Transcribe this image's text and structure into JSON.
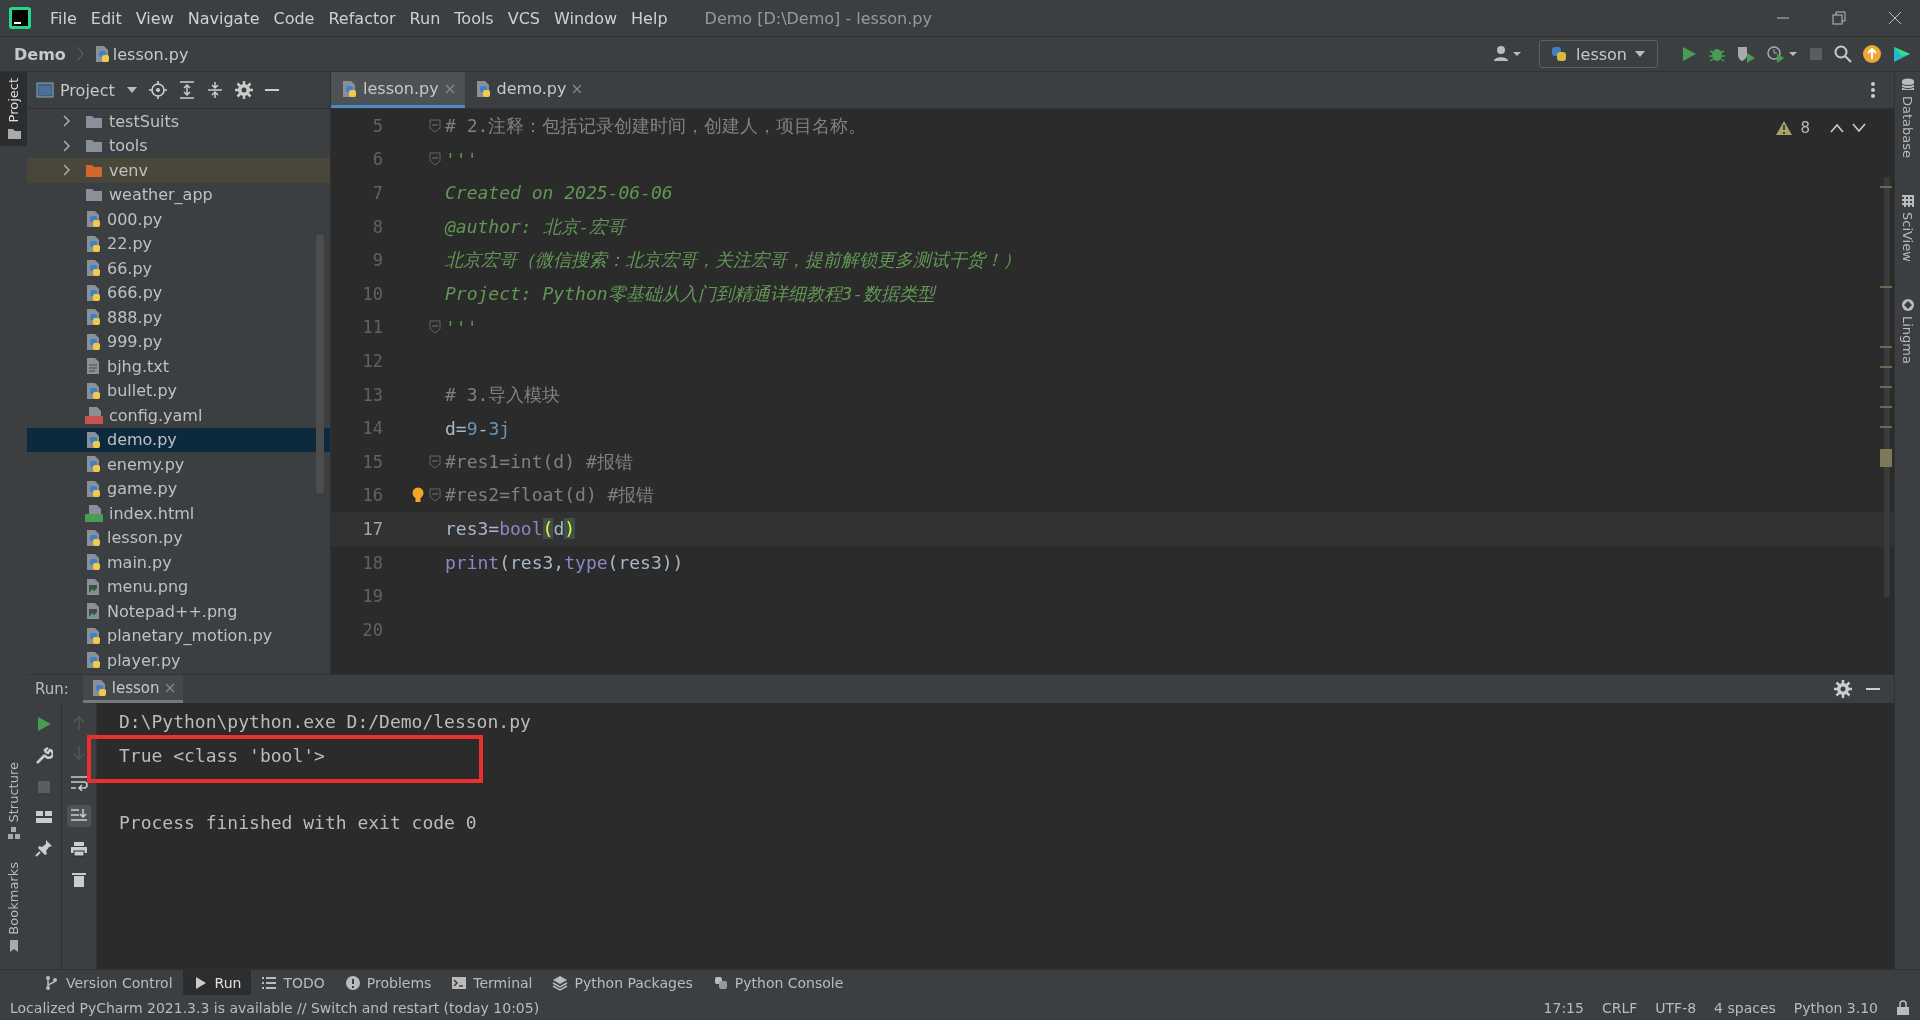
{
  "window": {
    "title": "Demo [D:\\Demo] - lesson.py"
  },
  "menu": [
    "File",
    "Edit",
    "View",
    "Navigate",
    "Code",
    "Refactor",
    "Run",
    "Tools",
    "VCS",
    "Window",
    "Help"
  ],
  "breadcrumb": [
    {
      "label": "Demo",
      "kind": "project"
    },
    {
      "label": "lesson.py",
      "kind": "python"
    }
  ],
  "run_config": {
    "label": "lesson"
  },
  "left_stripe": [
    {
      "label": "Project",
      "selected": true,
      "kind": "project"
    },
    {
      "label": "Structure",
      "selected": false,
      "kind": "structure"
    },
    {
      "label": "Bookmarks",
      "selected": false,
      "kind": "bookmarks"
    }
  ],
  "right_stripe": [
    {
      "label": "Database",
      "kind": "database"
    },
    {
      "label": "SciView",
      "kind": "sciview"
    },
    {
      "label": "Lingma",
      "kind": "lingma"
    }
  ],
  "project_panel": {
    "title": "Project",
    "items": [
      {
        "label": "testSuits",
        "kind": "folder",
        "expanded": false,
        "selected": false
      },
      {
        "label": "tools",
        "kind": "folder",
        "expanded": false,
        "selected": false
      },
      {
        "label": "venv",
        "kind": "excluded",
        "expanded": false,
        "selected": false
      },
      {
        "label": "weather_app",
        "kind": "folder",
        "selected": false
      },
      {
        "label": "000.py",
        "kind": "python",
        "selected": false
      },
      {
        "label": "22.py",
        "kind": "python",
        "selected": false
      },
      {
        "label": "66.py",
        "kind": "python",
        "selected": false
      },
      {
        "label": "666.py",
        "kind": "python",
        "selected": false
      },
      {
        "label": "888.py",
        "kind": "python",
        "selected": false
      },
      {
        "label": "999.py",
        "kind": "python",
        "selected": false
      },
      {
        "label": "bjhg.txt",
        "kind": "text",
        "selected": false
      },
      {
        "label": "bullet.py",
        "kind": "python",
        "selected": false
      },
      {
        "label": "config.yaml",
        "kind": "yaml",
        "selected": false
      },
      {
        "label": "demo.py",
        "kind": "python",
        "selected": true
      },
      {
        "label": "enemy.py",
        "kind": "python",
        "selected": false
      },
      {
        "label": "game.py",
        "kind": "python",
        "selected": false
      },
      {
        "label": "index.html",
        "kind": "html",
        "selected": false
      },
      {
        "label": "lesson.py",
        "kind": "python",
        "selected": false
      },
      {
        "label": "main.py",
        "kind": "python",
        "selected": false
      },
      {
        "label": "menu.png",
        "kind": "image",
        "selected": false
      },
      {
        "label": "Notepad++.png",
        "kind": "image",
        "selected": false
      },
      {
        "label": "planetary_motion.py",
        "kind": "python",
        "selected": false
      },
      {
        "label": "player.py",
        "kind": "python",
        "selected": false
      }
    ]
  },
  "editor": {
    "tabs": [
      {
        "label": "lesson.py",
        "selected": true
      },
      {
        "label": "demo.py",
        "selected": false
      }
    ],
    "warnings": "8",
    "lines": [
      {
        "number": "5",
        "fold": true,
        "current": false,
        "tokens": [
          {
            "kind": "comment",
            "text": "# 2.注释：包括记录创建时间，创建人，项目名称。"
          }
        ]
      },
      {
        "number": "6",
        "fold": true,
        "current": false,
        "tokens": [
          {
            "kind": "doc",
            "text": "'''"
          }
        ]
      },
      {
        "number": "7",
        "fold": false,
        "current": false,
        "tokens": [
          {
            "kind": "doc",
            "text": "Created on 2025-06-06"
          }
        ]
      },
      {
        "number": "8",
        "fold": false,
        "current": false,
        "tokens": [
          {
            "kind": "doc",
            "text": "@author: 北京-宏哥"
          }
        ]
      },
      {
        "number": "9",
        "fold": false,
        "current": false,
        "tokens": [
          {
            "kind": "doc",
            "text": "北京宏哥（微信搜索：北京宏哥，关注宏哥，提前解锁更多测试干货！）"
          }
        ]
      },
      {
        "number": "10",
        "fold": false,
        "current": false,
        "tokens": [
          {
            "kind": "doc",
            "text": "Project: Python零基础从入门到精通详细教程3-数据类型"
          }
        ]
      },
      {
        "number": "11",
        "fold": true,
        "current": false,
        "tokens": [
          {
            "kind": "doc",
            "text": "'''"
          }
        ]
      },
      {
        "number": "12",
        "fold": false,
        "current": false
      },
      {
        "number": "13",
        "fold": false,
        "current": false,
        "tokens": [
          {
            "kind": "comment",
            "text": "# 3.导入模块"
          }
        ]
      },
      {
        "number": "14",
        "fold": false,
        "current": false,
        "tokens": [
          {
            "kind": "plain",
            "text": "d="
          },
          {
            "kind": "number",
            "text": "9"
          },
          {
            "kind": "plain",
            "text": "-"
          },
          {
            "kind": "number",
            "text": "3j"
          }
        ]
      },
      {
        "number": "15",
        "fold": true,
        "current": false,
        "tokens": [
          {
            "kind": "comment",
            "text": "#res1=int(d) #报错"
          }
        ]
      },
      {
        "number": "16",
        "fold": true,
        "current": false,
        "bulb": true,
        "tokens": [
          {
            "kind": "comment",
            "text": "#res2=float(d) #报错"
          }
        ]
      },
      {
        "number": "17",
        "fold": false,
        "current": true,
        "tokens": [
          {
            "kind": "plain",
            "text": "res3="
          },
          {
            "kind": "builtin",
            "text": "bool"
          },
          {
            "kind": "match",
            "text": "("
          },
          {
            "kind": "plain",
            "text": "d"
          },
          {
            "kind": "match",
            "text": ")"
          }
        ]
      },
      {
        "number": "18",
        "fold": false,
        "current": false,
        "tokens": [
          {
            "kind": "builtin",
            "text": "print"
          },
          {
            "kind": "plain",
            "text": "(res3,"
          },
          {
            "kind": "builtin",
            "text": "type"
          },
          {
            "kind": "plain",
            "text": "(res3))"
          }
        ]
      },
      {
        "number": "19",
        "fold": false,
        "current": false
      },
      {
        "number": "20",
        "fold": false,
        "current": false
      }
    ]
  },
  "run_panel": {
    "label": "Run:",
    "tabs": [
      {
        "label": "lesson",
        "selected": true
      }
    ],
    "console": [
      {
        "text": "D:\\Python\\python.exe D:/Demo/lesson.py",
        "highlighted": false
      },
      {
        "text": "True <class 'bool'>",
        "highlighted": true
      },
      {
        "highlighted": false
      },
      {
        "text": "Process finished with exit code 0",
        "highlighted": false
      }
    ]
  },
  "tool_windows": [
    {
      "label": "Version Control",
      "kind": "vcs",
      "selected": false
    },
    {
      "label": "Run",
      "kind": "run",
      "selected": true
    },
    {
      "label": "TODO",
      "kind": "todo",
      "selected": false
    },
    {
      "label": "Problems",
      "kind": "problems",
      "selected": false
    },
    {
      "label": "Terminal",
      "kind": "terminal",
      "selected": false
    },
    {
      "label": "Python Packages",
      "kind": "packages",
      "selected": false
    },
    {
      "label": "Python Console",
      "kind": "console",
      "selected": false
    }
  ],
  "status_bar": {
    "message": "Localized PyCharm 2021.3.3 is available // Switch and restart (today 10:05)",
    "items": [
      "17:15",
      "CRLF",
      "UTF-8",
      "4 spaces",
      "Python 3.10"
    ]
  }
}
